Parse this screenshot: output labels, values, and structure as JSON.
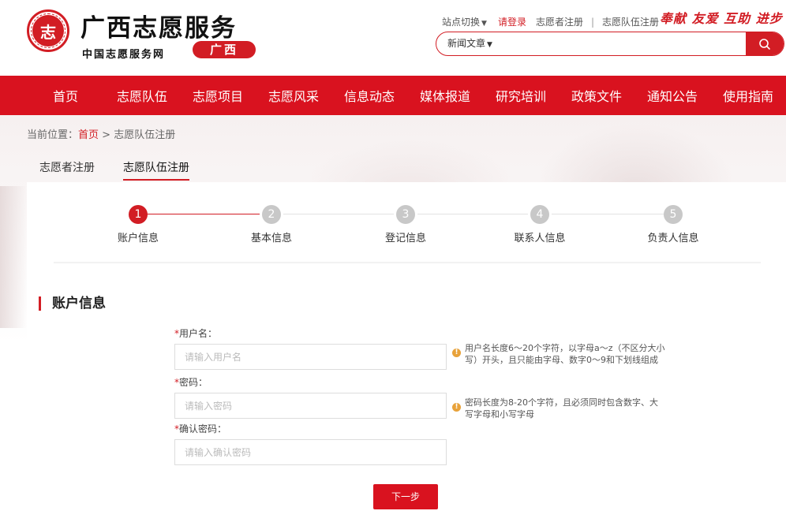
{
  "header": {
    "logo_text": "志",
    "site_title": "广西志愿服务",
    "site_subtitle": "中国志愿服务网",
    "region": "广西",
    "site_switch": "站点切换",
    "login": "请登录",
    "volunteer_register": "志愿者注册",
    "separator": "|",
    "team_register": "志愿队伍注册",
    "slogan": "奉献 友爱 互助 进步",
    "search": {
      "category": "新闻文章",
      "placeholder": ""
    }
  },
  "nav": [
    "首页",
    "志愿队伍",
    "志愿项目",
    "志愿风采",
    "信息动态",
    "媒体报道",
    "研究培训",
    "政策文件",
    "通知公告",
    "使用指南"
  ],
  "breadcrumb": {
    "prefix": "当前位置：",
    "home": "首页",
    "sep": ">",
    "current": "志愿队伍注册"
  },
  "subtabs": [
    {
      "label": "志愿者注册",
      "active": false
    },
    {
      "label": "志愿队伍注册",
      "active": true
    }
  ],
  "steps": [
    {
      "num": "1",
      "label": "账户信息",
      "active": true
    },
    {
      "num": "2",
      "label": "基本信息",
      "active": false
    },
    {
      "num": "3",
      "label": "登记信息",
      "active": false
    },
    {
      "num": "4",
      "label": "联系人信息",
      "active": false
    },
    {
      "num": "5",
      "label": "负责人信息",
      "active": false
    }
  ],
  "section_title": "账户信息",
  "form": {
    "username": {
      "label": "用户名：",
      "placeholder": "请输入用户名",
      "value": "",
      "hint": "用户名长度6～20个字符，以字母a～z（不区分大小写）开头，且只能由字母、数字0～9和下划线组成"
    },
    "password": {
      "label": "密码：",
      "placeholder": "请输入密码",
      "value": "",
      "hint": "密码长度为8-20个字符，且必须同时包含数字、大写字母和小写字母"
    },
    "confirm": {
      "label": "确认密码：",
      "placeholder": "请输入确认密码",
      "value": ""
    },
    "required_mark": "*",
    "warn_glyph": "!"
  },
  "next_button": "下一步",
  "colors": {
    "brand_red": "#d21d24",
    "nav_red": "#d9121f",
    "step_inactive": "#c8c8c8",
    "hint_warning": "#e8a23a"
  }
}
